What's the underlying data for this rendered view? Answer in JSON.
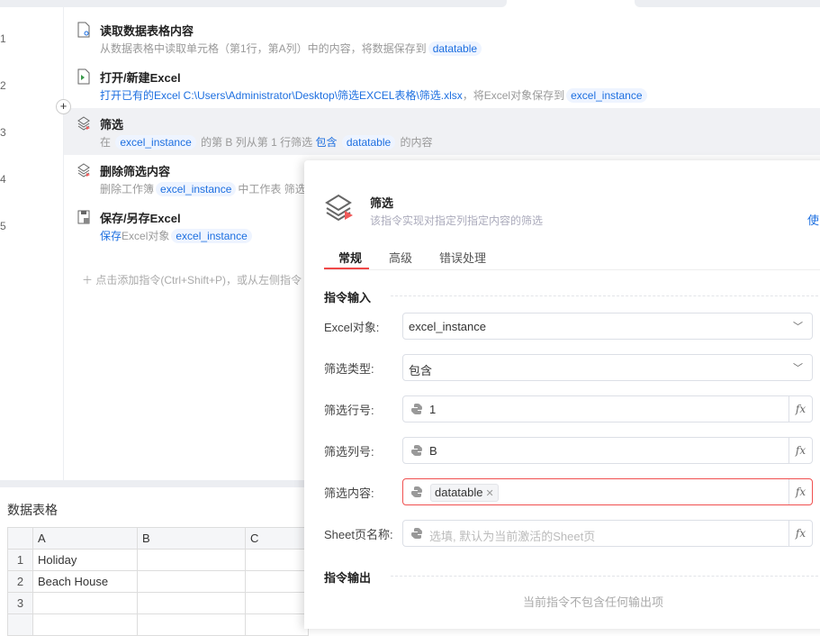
{
  "gutter": [
    "1",
    "2",
    "3",
    "4",
    "5"
  ],
  "steps": [
    {
      "title": "读取数据表格内容",
      "desc_prefix": "从数据表格中读取单元格（第1行，第A列）中的内容，将数据保存到",
      "var": "datatable"
    },
    {
      "title": "打开/新建Excel",
      "desc_link": "打开已有的Excel C:\\Users\\Administrator\\Desktop\\筛选EXCEL表格\\筛选.xlsx",
      "desc_mid": "，将Excel对象保存到",
      "var": "excel_instance"
    },
    {
      "title": "筛选",
      "p1": "在",
      "var1": "excel_instance",
      "p2": "的第 B 列从第 1 行筛选",
      "kw": "包含",
      "var2": "datatable",
      "p3": "的内容"
    },
    {
      "title": "删除筛选内容",
      "p1": "删除工作簿",
      "var": "excel_instance",
      "p2": "中工作表  筛选"
    },
    {
      "title": "保存/另存Excel",
      "link": "保存",
      "p1": "Excel对象",
      "var": "excel_instance"
    }
  ],
  "add_hint": "点击添加指令(Ctrl+Shift+P)，或从左侧指令",
  "datatable": {
    "label": "数据表格",
    "columns": [
      "A",
      "B",
      "C"
    ],
    "rows": [
      {
        "n": "1",
        "a": "Holiday"
      },
      {
        "n": "2",
        "a": "Beach House"
      },
      {
        "n": "3",
        "a": ""
      }
    ]
  },
  "dialog": {
    "title": "筛选",
    "subtitle": "该指令实现对指定列指定内容的筛选",
    "help": "使",
    "tabs": [
      "常规",
      "高级",
      "错误处理"
    ],
    "input_section": "指令输入",
    "fields": {
      "excel_label": "Excel对象:",
      "excel_value": "excel_instance",
      "type_label": "筛选类型:",
      "type_value": "包含",
      "row_label": "筛选行号:",
      "row_value": "1",
      "col_label": "筛选列号:",
      "col_value": "B",
      "content_label": "筛选内容:",
      "content_tag": "datatable",
      "sheet_label": "Sheet页名称:",
      "sheet_placeholder": "选填, 默认为当前激活的Sheet页"
    },
    "output_section": "指令输出",
    "no_output": "当前指令不包含任何输出项"
  }
}
